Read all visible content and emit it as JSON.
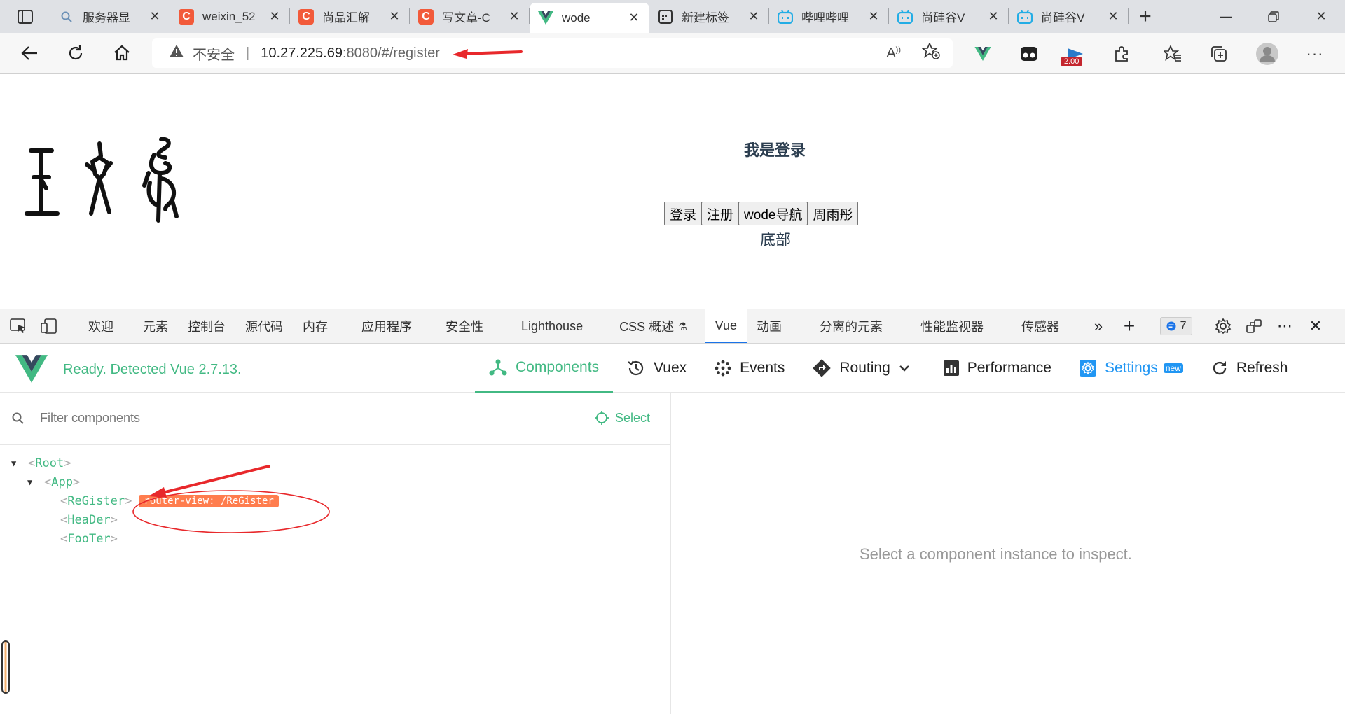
{
  "browser": {
    "tabs": [
      {
        "title": "服务器显",
        "favicon": "search-icon"
      },
      {
        "title": "weixin_52",
        "favicon": "csdn-icon"
      },
      {
        "title": "尚品汇解",
        "favicon": "csdn-icon"
      },
      {
        "title": "写文章-C",
        "favicon": "csdn-icon"
      },
      {
        "title": "wode",
        "favicon": "vue-icon"
      },
      {
        "title": "新建标签",
        "favicon": "newtab-icon"
      },
      {
        "title": "哔哩哔哩",
        "favicon": "bilibili-icon"
      },
      {
        "title": "尚硅谷V",
        "favicon": "bilibili-icon"
      },
      {
        "title": "尚硅谷V",
        "favicon": "bilibili-icon"
      }
    ],
    "address": {
      "insecure_label": "不安全",
      "url_host": "10.27.225.69",
      "url_rest": ":8080/#/register"
    },
    "extension_badge": "2.00"
  },
  "page": {
    "title": "我是登录",
    "buttons": [
      "登录",
      "注册",
      "wode导航",
      "周雨彤"
    ],
    "footer": "底部"
  },
  "devtools": {
    "tabs": [
      "欢迎",
      "元素",
      "控制台",
      "源代码",
      "内存",
      "应用程序",
      "安全性",
      "Lighthouse",
      "CSS 概述",
      "Vue",
      "动画",
      "分离的元素",
      "性能监视器",
      "传感器"
    ],
    "active_tab": "Vue",
    "message_count": "7"
  },
  "vue_devtools": {
    "status": "Ready. Detected Vue 2.7.13.",
    "nav": {
      "components": "Components",
      "vuex": "Vuex",
      "events": "Events",
      "routing": "Routing",
      "performance": "Performance",
      "settings": "Settings",
      "settings_badge": "new",
      "refresh": "Refresh"
    },
    "filter_placeholder": "Filter components",
    "select_label": "Select",
    "tree": {
      "root": "Root",
      "app": "App",
      "register": "ReGister",
      "register_tag": "router-view: /ReGister",
      "header": "HeaDer",
      "footer": "FooTer"
    },
    "inspect_message": "Select a component instance to inspect."
  },
  "colors": {
    "vue_green": "#42b983",
    "tag_orange": "#ff7d4e",
    "annotation_red": "#e8282b"
  }
}
